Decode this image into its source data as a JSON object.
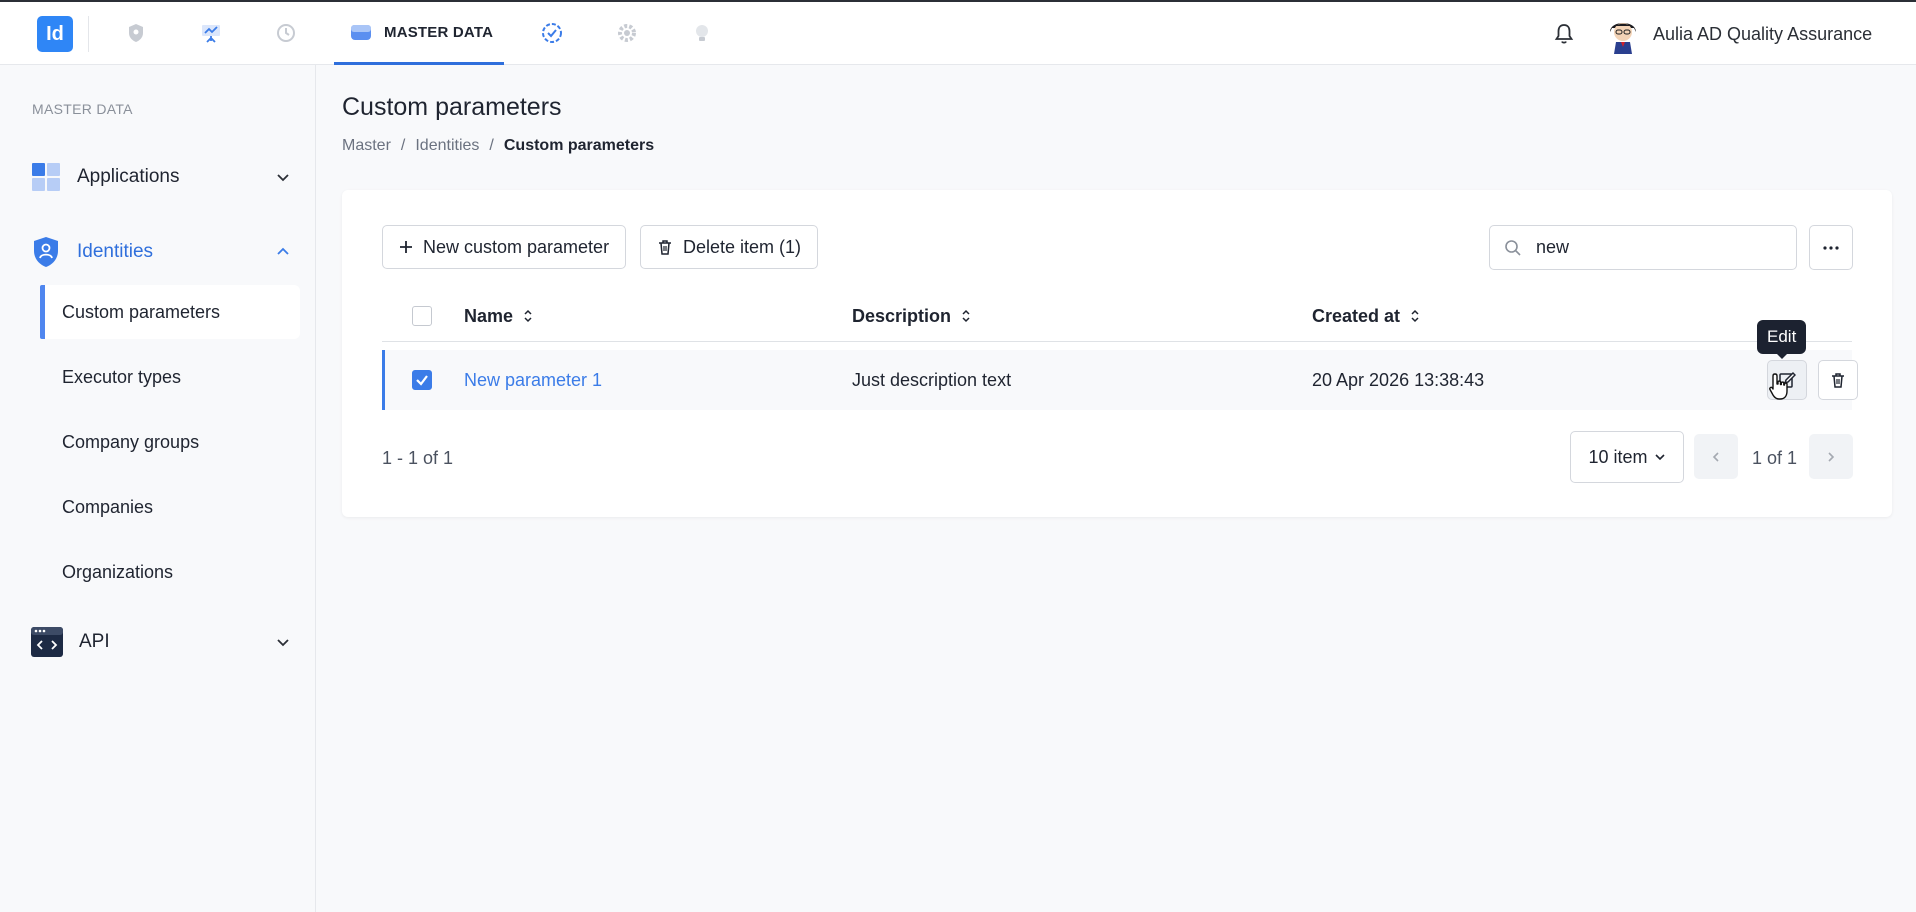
{
  "app": {
    "logo_text": "Id"
  },
  "topnav": {
    "active_tab_label": "MASTER DATA",
    "icons": [
      "shield-icon",
      "presentation-icon",
      "history-clock-icon",
      "database-icon",
      "check-badge-icon",
      "gear-icon",
      "lightbulb-icon"
    ]
  },
  "user": {
    "name": "Aulia AD Quality Assurance"
  },
  "sidebar": {
    "section_label": "MASTER DATA",
    "groups": [
      {
        "label": "Applications"
      },
      {
        "label": "Identities"
      },
      {
        "label": "API"
      }
    ],
    "items": [
      {
        "label": "Custom parameters"
      },
      {
        "label": "Executor types"
      },
      {
        "label": "Company groups"
      },
      {
        "label": "Companies"
      },
      {
        "label": "Organizations"
      }
    ]
  },
  "page": {
    "title": "Custom parameters",
    "breadcrumb": [
      "Master",
      "Identities",
      "Custom parameters"
    ],
    "separator": "/"
  },
  "toolbar": {
    "new_label": "New custom parameter",
    "delete_label": "Delete item (1)",
    "search_value": "new"
  },
  "table": {
    "columns": [
      "Name",
      "Description",
      "Created at"
    ],
    "rows": [
      {
        "name": "New parameter 1",
        "description": "Just description text",
        "created_at": "20 Apr 2026 13:38:43",
        "checked": true
      }
    ],
    "tooltip": "Edit"
  },
  "pagination": {
    "range_text": "1 - 1 of 1",
    "per_page": "10 item",
    "page_text": "1 of 1"
  },
  "colors": {
    "accent": "#3b7ce8",
    "tooltip_bg": "#1c2230"
  }
}
